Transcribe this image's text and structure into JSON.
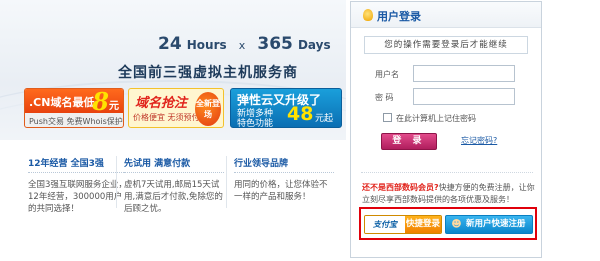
{
  "banner": {
    "hours_num": "24",
    "hours_word": "Hours",
    "times": "x",
    "days_num": "365",
    "days_word": "Days",
    "slogan": "全国前三强虚拟主机服务商",
    "promo_cn": {
      "title": ".CN域名最低",
      "price": "8",
      "unit": "元",
      "footer": "Push交易  免费Whois保护"
    },
    "promo_domain": {
      "title": "域名抢注",
      "subtitle": "价格便宜  无须预付",
      "badge": "全新登场"
    },
    "promo_cloud": {
      "title": "弹性云又升级了",
      "line1": "新增多种",
      "line2": "特色功能",
      "price": "48",
      "unit": "元起"
    }
  },
  "features": [
    {
      "title": "12年经营 全国3强",
      "text": "全国3强互联网服务企业，12年经营，300000用户的共同选择！"
    },
    {
      "title": "先试用 满意付款",
      "text": "虚机7天试用,邮局15天试用,满意后才付款,免除您的后顾之忧。"
    },
    {
      "title": "行业领导品牌",
      "text": "用同的价格，让您体验不一样的产品和服务！"
    }
  ],
  "login": {
    "title": "用户登录",
    "notice": "您的操作需要登录后才能继续",
    "username_label": "用户名",
    "password_label": "密  码",
    "username_value": "",
    "password_value": "",
    "remember_label": "在此计算机上记住密码",
    "submit_label": "登 录",
    "forgot_label": "忘记密码?",
    "register_highlight": "还不是西部数码会员?",
    "register_text": "快捷方便的免费注册，让你立刻尽享西部数码提供的各项优惠及服务！",
    "alipay_label": "支付宝",
    "quick_login_label": "快捷登录",
    "new_user_label": "新用户快速注册"
  }
}
